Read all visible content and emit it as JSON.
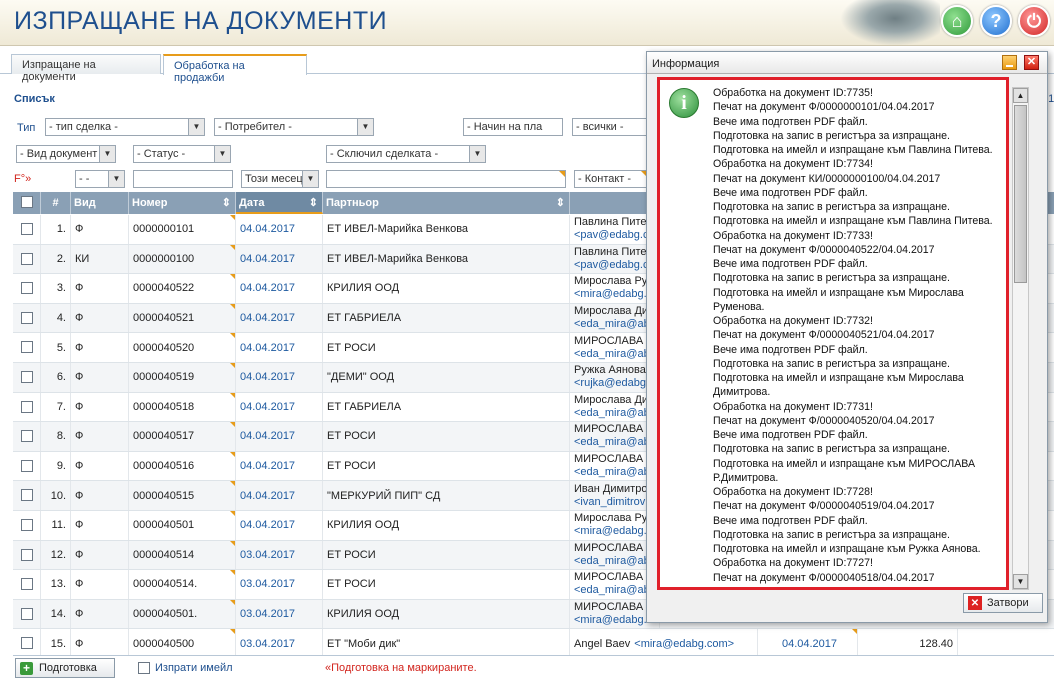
{
  "header": {
    "title": "ИЗПРАЩАНЕ НА ДОКУМЕНТИ"
  },
  "tabs": [
    {
      "label": "Изпращане на документи"
    },
    {
      "label": "Обработка на продажби"
    }
  ],
  "section_title": "Списък",
  "filters": {
    "type_label": "Тип",
    "deal_type": "- тип сделка -",
    "user": "- Потребител -",
    "payment": "- Начин на пла",
    "all": "- всички -",
    "doc_type": "- Вид документ",
    "status": "- Статус -",
    "concluded": "- Сключил сделката -",
    "f_label": "F°»",
    "dashes": "- -",
    "period": "Този месец",
    "contact": "- Контакт -",
    "right_cut": "21"
  },
  "columns": {
    "n": "#",
    "vid": "Вид",
    "nomer": "Номер",
    "data": "Дата",
    "partner": "Партньор",
    "contact": "К"
  },
  "rows": [
    {
      "n": "1.",
      "vid": "Ф",
      "nomer": "0000000101",
      "date": "04.04.2017",
      "partner": "ЕТ ИВЕЛ-Марийка Венкова",
      "c1": "Павлина Питев",
      "c2": "<pav@edabg.co"
    },
    {
      "n": "2.",
      "vid": "КИ",
      "nomer": "0000000100",
      "date": "04.04.2017",
      "partner": "ЕТ ИВЕЛ-Марийка Венкова",
      "c1": "Павлина Питев",
      "c2": "<pav@edabg.co"
    },
    {
      "n": "3.",
      "vid": "Ф",
      "nomer": "0000040522",
      "date": "04.04.2017",
      "partner": "КРИЛИЯ ООД",
      "c1": "Мирослава Рум",
      "c2": "<mira@edabg.co"
    },
    {
      "n": "4.",
      "vid": "Ф",
      "nomer": "0000040521",
      "date": "04.04.2017",
      "partner": "ЕТ ГАБРИЕЛА",
      "c1": "Мирослава Дим",
      "c2": "<eda_mira@abv"
    },
    {
      "n": "5.",
      "vid": "Ф",
      "nomer": "0000040520",
      "date": "04.04.2017",
      "partner": "ЕТ РОСИ",
      "c1": "МИРОСЛАВА Р.",
      "c2": "<eda_mira@abv"
    },
    {
      "n": "6.",
      "vid": "Ф",
      "nomer": "0000040519",
      "date": "04.04.2017",
      "partner": "\"ДЕМИ\" ООД",
      "c1": "Ружка Аянова",
      "c2": "<rujka@edabg."
    },
    {
      "n": "7.",
      "vid": "Ф",
      "nomer": "0000040518",
      "date": "04.04.2017",
      "partner": "ЕТ ГАБРИЕЛА",
      "c1": "Мирослава Дим",
      "c2": "<eda_mira@abv"
    },
    {
      "n": "8.",
      "vid": "Ф",
      "nomer": "0000040517",
      "date": "04.04.2017",
      "partner": "ЕТ РОСИ",
      "c1": "МИРОСЛАВА Р.",
      "c2": "<eda_mira@abv"
    },
    {
      "n": "9.",
      "vid": "Ф",
      "nomer": "0000040516",
      "date": "04.04.2017",
      "partner": "ЕТ РОСИ",
      "c1": "МИРОСЛАВА Р.",
      "c2": "<eda_mira@abv"
    },
    {
      "n": "10.",
      "vid": "Ф",
      "nomer": "0000040515",
      "date": "04.04.2017",
      "partner": "\"МЕРКУРИЙ ПИП\" СД",
      "c1": "Иван Димитров",
      "c2": "<ivan_dimitrov"
    },
    {
      "n": "11.",
      "vid": "Ф",
      "nomer": "0000040501",
      "date": "04.04.2017",
      "partner": "КРИЛИЯ ООД",
      "c1": "Мирослава Рум",
      "c2": "<mira@edabg.co"
    },
    {
      "n": "12.",
      "vid": "Ф",
      "nomer": "0000040514",
      "date": "03.04.2017",
      "partner": "ЕТ РОСИ",
      "c1": "МИРОСЛАВА Р.",
      "c2": "<eda_mira@abv"
    },
    {
      "n": "13.",
      "vid": "Ф",
      "nomer": "0000040514.",
      "date": "03.04.2017",
      "partner": "ЕТ РОСИ",
      "c1": "МИРОСЛАВА Р.",
      "c2": "<eda_mira@abv"
    },
    {
      "n": "14.",
      "vid": "Ф",
      "nomer": "0000040501.",
      "date": "03.04.2017",
      "partner": "КРИЛИЯ ООД",
      "c1": "МИРОСЛАВА Рум",
      "c2": "<mira@edabg.com>"
    },
    {
      "n": "15.",
      "vid": "Ф",
      "nomer": "0000040500",
      "date": "03.04.2017",
      "partner": "ЕТ \"Моби дик\"",
      "c1": "Angel Baev",
      "c2": "<mira@edabg.com>",
      "date2": "04.04.2017",
      "amount": "128.40"
    }
  ],
  "footer": {
    "prepare": "Подготовка",
    "send_email": "Изпрати имейл",
    "note_mark": "«",
    "note": "Подготовка на маркираните."
  },
  "dialog": {
    "title": "Информация",
    "lines": [
      "Обработка на документ ID:7735!",
      "Печат на документ Ф/0000000101/04.04.2017",
      "Вече има подготвен PDF файл.",
      "Подготовка на запис в регистъра за изпращане.",
      "Подготовка на имейл и изпращане към Павлина Питева.",
      "Обработка на документ ID:7734!",
      "Печат на документ КИ/0000000100/04.04.2017",
      "Вече има подготвен PDF файл.",
      "Подготовка на запис в регистъра за изпращане.",
      "Подготовка на имейл и изпращане към Павлина Питева.",
      "Обработка на документ ID:7733!",
      "Печат на документ Ф/0000040522/04.04.2017",
      "Вече има подготвен PDF файл.",
      "Подготовка на запис в регистъра за изпращане.",
      "Подготовка на имейл и изпращане към Мирослава",
      "Руменова.",
      "Обработка на документ ID:7732!",
      "Печат на документ Ф/0000040521/04.04.2017",
      "Вече има подготвен PDF файл.",
      "Подготовка на запис в регистъра за изпращане.",
      "Подготовка на имейл и изпращане към Мирослава",
      "Димитрова.",
      "Обработка на документ ID:7731!",
      "Печат на документ Ф/0000040520/04.04.2017",
      "Вече има подготвен PDF файл.",
      "Подготовка на запис в регистъра за изпращане.",
      "Подготовка на имейл и изпращане към МИРОСЛАВА",
      "Р.Димитрова.",
      "Обработка на документ ID:7728!",
      "Печат на документ Ф/0000040519/04.04.2017",
      "Вече има подготвен PDF файл.",
      "Подготовка на запис в регистъра за изпращане.",
      "Подготовка на имейл и изпращане към Ружка Аянова.",
      "Обработка на документ ID:7727!",
      "Печат на документ Ф/0000040518/04.04.2017"
    ],
    "close_label": "Затвори"
  }
}
